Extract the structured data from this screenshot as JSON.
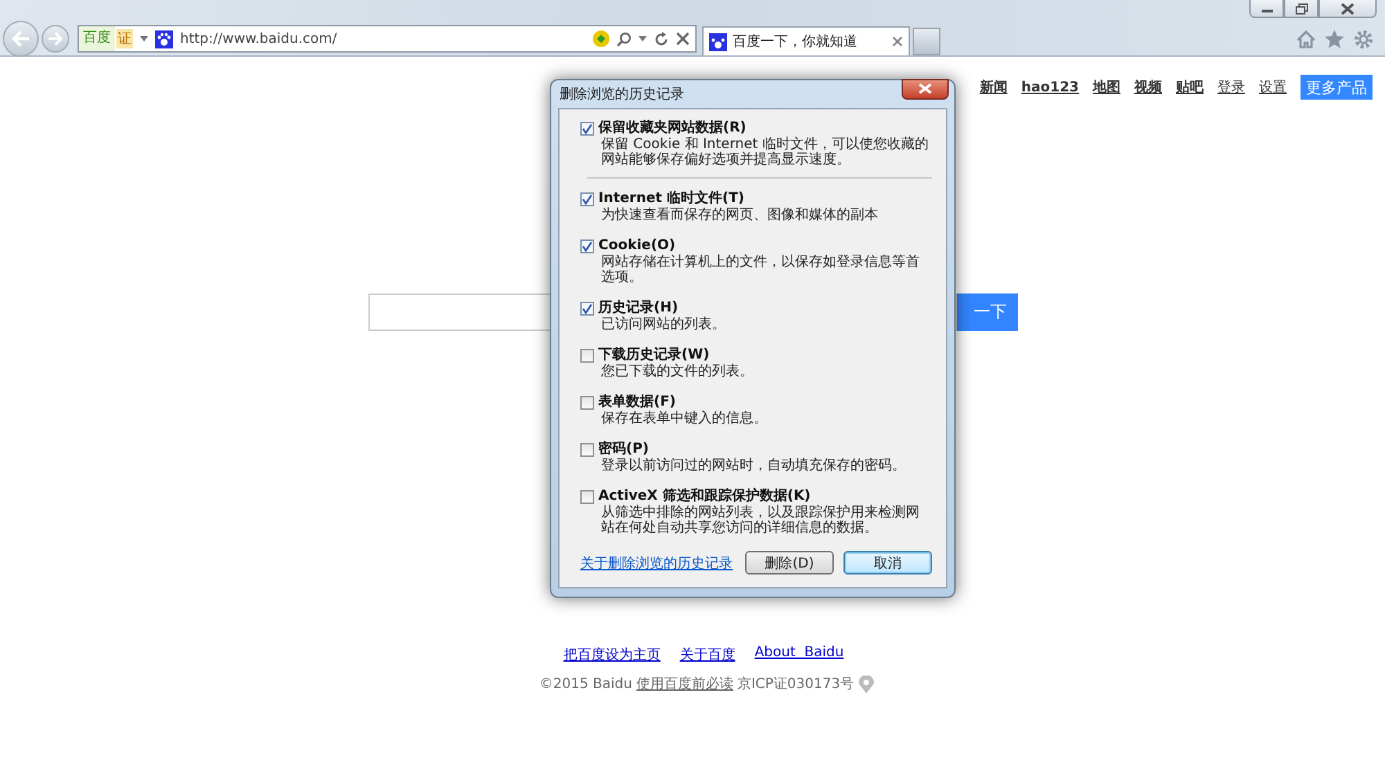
{
  "browser": {
    "address_bar": {
      "badge": "百度",
      "cert": "证",
      "url": "http://www.baidu.com/"
    },
    "tab": {
      "title": "百度一下，你就知道"
    }
  },
  "page": {
    "nav": [
      "新闻",
      "hao123",
      "地图",
      "视频",
      "贴吧",
      "登录",
      "设置"
    ],
    "more_button": "更多产品",
    "search_button": "一下",
    "footer_links": [
      "把百度设为主页",
      "关于百度",
      "About  Baidu"
    ],
    "copyright": "©2015 Baidu",
    "terms_link": "使用百度前必读",
    "icp": "京ICP证030173号"
  },
  "dialog": {
    "title": "删除浏览的历史记录",
    "options": [
      {
        "label": "保留收藏夹网站数据(R)",
        "description": "保留 Cookie 和 Internet 临时文件，可以使您收藏的网站能够保存偏好选项并提高显示速度。",
        "checked": true
      },
      {
        "label": "Internet 临时文件(T)",
        "description": "为快速查看而保存的网页、图像和媒体的副本",
        "checked": true
      },
      {
        "label": "Cookie(O)",
        "description": "网站存储在计算机上的文件，以保存如登录信息等首选项。",
        "checked": true
      },
      {
        "label": "历史记录(H)",
        "description": "已访问网站的列表。",
        "checked": true
      },
      {
        "label": "下载历史记录(W)",
        "description": "您已下载的文件的列表。",
        "checked": false
      },
      {
        "label": "表单数据(F)",
        "description": "保存在表单中键入的信息。",
        "checked": false
      },
      {
        "label": "密码(P)",
        "description": "登录以前访问过的网站时，自动填充保存的密码。",
        "checked": false
      },
      {
        "label": "ActiveX 筛选和跟踪保护数据(K)",
        "description": "从筛选中排除的网站列表，以及跟踪保护用来检测网站在何处自动共享您访问的详细信息的数据。",
        "checked": false
      }
    ],
    "link": "关于删除浏览的历史记录",
    "buttons": [
      {
        "label": "删除(D)",
        "default": false
      },
      {
        "label": "取消",
        "default": true
      }
    ]
  }
}
